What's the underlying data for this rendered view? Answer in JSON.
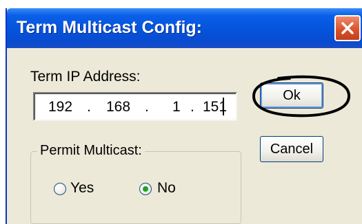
{
  "window": {
    "title": "Term Multicast Config:"
  },
  "form": {
    "ip_label": "Term IP Address:",
    "ip_octets": [
      "192",
      "168",
      "1",
      "151"
    ],
    "ip_separator": "."
  },
  "buttons": {
    "ok_label": "Ok",
    "cancel_label": "Cancel"
  },
  "multicast": {
    "group_label": "Permit Multicast:",
    "options": [
      {
        "label": "Yes",
        "selected": false
      },
      {
        "label": "No",
        "selected": true
      }
    ]
  },
  "icons": {
    "close": "close-icon",
    "annotation": "hand-drawn-circle"
  },
  "colors": {
    "titlebar": "#0553db",
    "dialog_bg": "#ece9d8",
    "close_button": "#d8502a",
    "radio_selected": "#21a121"
  }
}
